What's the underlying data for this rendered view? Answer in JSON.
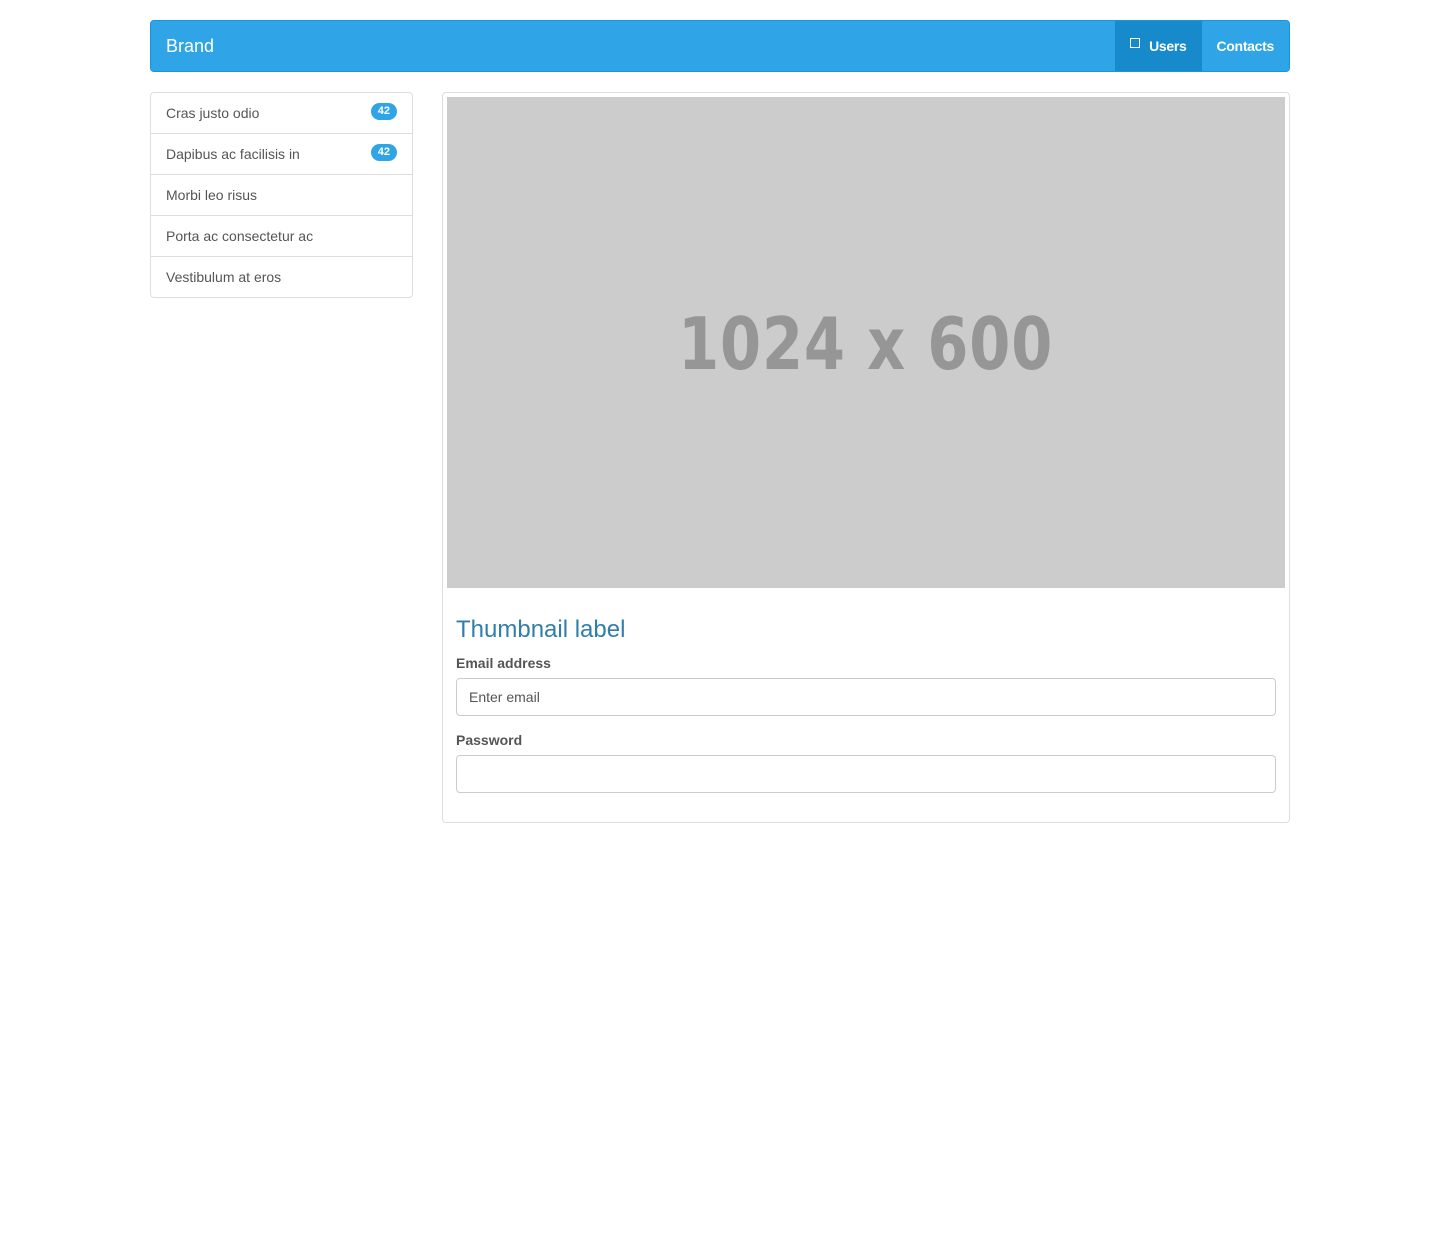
{
  "navbar": {
    "brand": "Brand",
    "items": [
      {
        "label": "Users",
        "icon": "square-outline-icon",
        "active": true
      },
      {
        "label": "Contacts",
        "active": false
      }
    ]
  },
  "sidebar": {
    "items": [
      {
        "label": "Cras justo odio",
        "badge": "42"
      },
      {
        "label": "Dapibus ac facilisis in",
        "badge": "42"
      },
      {
        "label": "Morbi leo risus"
      },
      {
        "label": "Porta ac consectetur ac"
      },
      {
        "label": "Vestibulum at eros"
      }
    ]
  },
  "thumbnail": {
    "image_text": "1024 x 600",
    "caption_title": "Thumbnail label"
  },
  "form": {
    "email_label": "Email address",
    "email_placeholder": "Enter email",
    "email_value": "",
    "password_label": "Password",
    "password_value": ""
  },
  "colors": {
    "primary": "#2fa4e7",
    "primary_active": "#178acc",
    "heading": "#317eac",
    "placeholder_bg": "#cccccc",
    "placeholder_text": "#969696"
  }
}
